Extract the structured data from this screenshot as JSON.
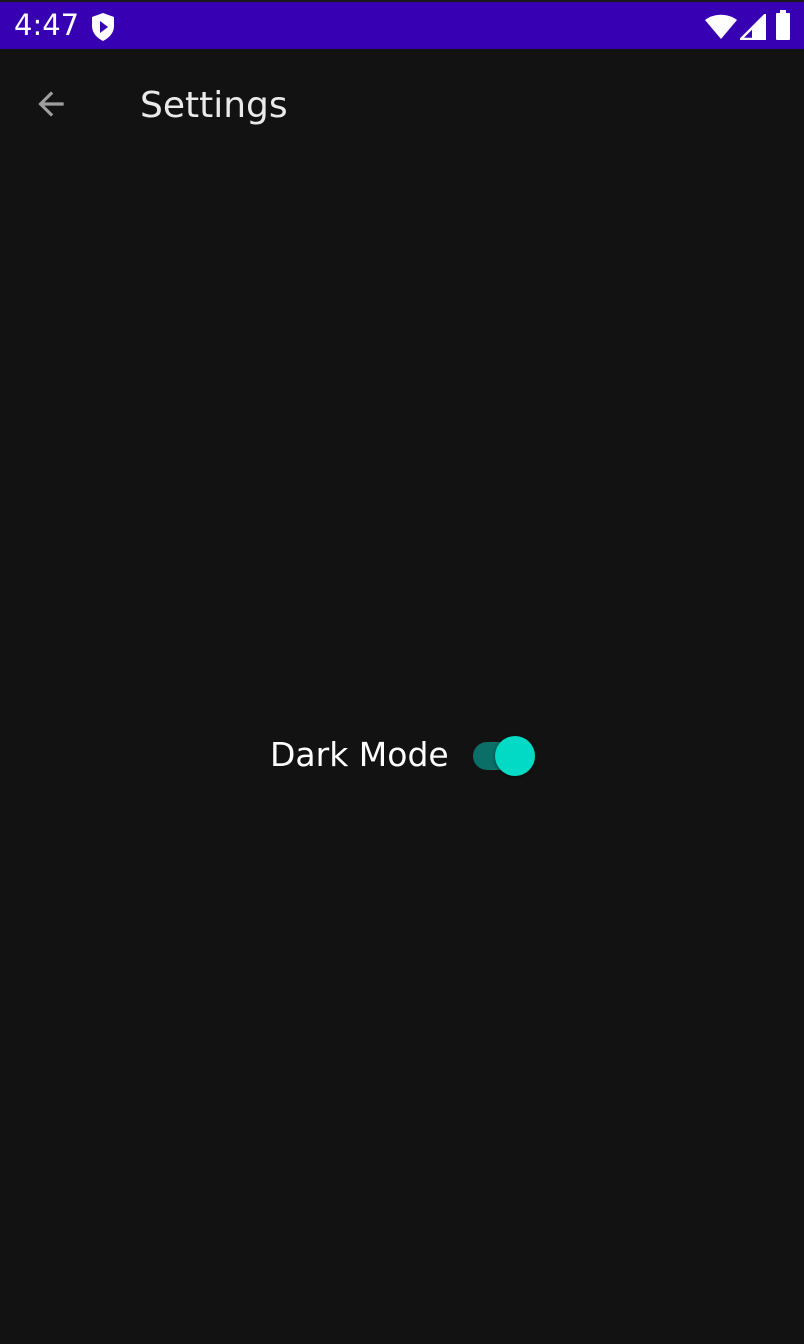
{
  "status_bar": {
    "time": "4:47",
    "background_color": "#3700b3",
    "icons": [
      "shield-icon",
      "wifi-icon",
      "cell-signal-icon",
      "battery-icon"
    ]
  },
  "app_bar": {
    "title": "Settings",
    "back_icon": "arrow-back-icon"
  },
  "settings": {
    "dark_mode": {
      "label": "Dark Mode",
      "enabled": true,
      "accent_color": "#03dac5"
    }
  },
  "colors": {
    "background": "#121212",
    "text": "#ffffff"
  }
}
